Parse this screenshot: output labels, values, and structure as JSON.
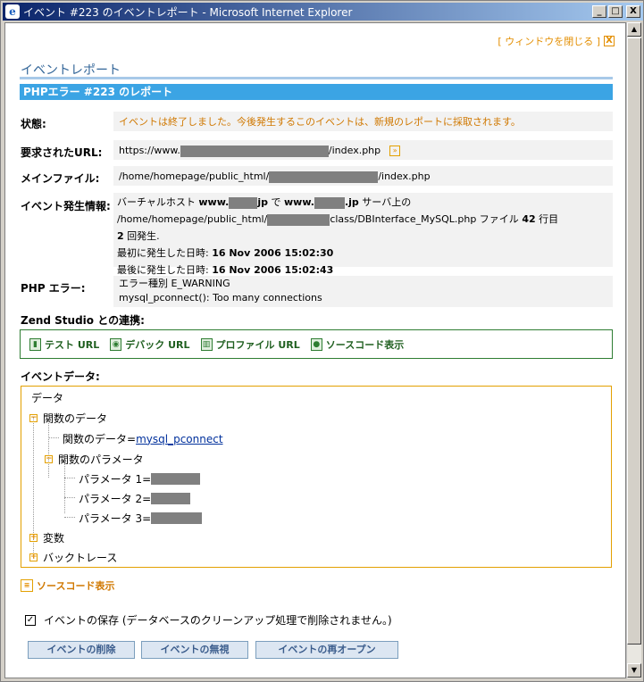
{
  "window": {
    "title": "イベント #223 のイベントレポート - Microsoft Internet Explorer",
    "minimize_glyph": "_",
    "maximize_glyph": "□",
    "close_glyph": "X"
  },
  "header": {
    "close_link": "[ ウィンドウを閉じる ]",
    "close_icon_glyph": "X",
    "title": "イベントレポート",
    "subheader": "PHPエラー #223 のレポート"
  },
  "details": {
    "status_label": "状態:",
    "status_value": "イベントは終了しました。今後発生するこのイベントは、新規のレポートに採取されます。",
    "url_label": "要求されたURL:",
    "url_prefix": "https://www.",
    "url_suffix": "/index.php",
    "main_file_label": "メインファイル:",
    "main_file_prefix": "/home/homepage/public_html/",
    "main_file_suffix": "/index.php",
    "event_info_label": "イベント発生情報:",
    "event_info_line1_a": "バーチャルホスト ",
    "event_info_line1_b": "www.",
    "event_info_line1_c": "jp",
    "event_info_line1_d": " で ",
    "event_info_line1_e": "www.",
    "event_info_line1_f": ".jp",
    "event_info_line1_g": " サーバ上の",
    "event_info_line2_a": "/home/homepage/public_html/",
    "event_info_line2_b": "class/DBInterface_MySQL.php ファイル ",
    "event_info_line2_c": "42",
    "event_info_line2_d": " 行目",
    "event_info_line3_a": "2",
    "event_info_line3_b": " 回発生.",
    "first_label": "最初に発生した日時: ",
    "first_value": "16 Nov 2006 15:02:30",
    "last_label": "最後に発生した日時: ",
    "last_value": "16 Nov 2006 15:02:43",
    "php_error_label": "PHP エラー:",
    "php_error_type": "エラー種別 E_WARNING",
    "php_error_msg": "mysql_pconnect(): Too many connections"
  },
  "zend": {
    "label": "Zend Studio との連携:",
    "links": [
      "テスト URL",
      "デバック URL",
      "プロファイル URL",
      "ソースコード表示"
    ]
  },
  "event_data": {
    "label": "イベントデータ:",
    "root": "データ",
    "func_data": "関数のデータ",
    "func_data_item": "関数のデータ",
    "equals": " = ",
    "func_data_value": "mysql_pconnect",
    "func_params": "関数のパラメータ",
    "param1": "パラメータ 1",
    "param2": "パラメータ 2",
    "param3": "パラメータ 3",
    "variables": "変数",
    "backtrace": "バックトレース",
    "collapse_glyph": "−",
    "expand_glyph": "+"
  },
  "source_link": "ソースコード表示",
  "save": {
    "checked": true,
    "check_glyph": "✓",
    "label": "イベントの保存 (データベースのクリーンアップ処理で削除されません。)"
  },
  "buttons": {
    "delete": "イベントの削除",
    "ignore": "イベントの無視",
    "reopen": "イベントの再オープン"
  }
}
